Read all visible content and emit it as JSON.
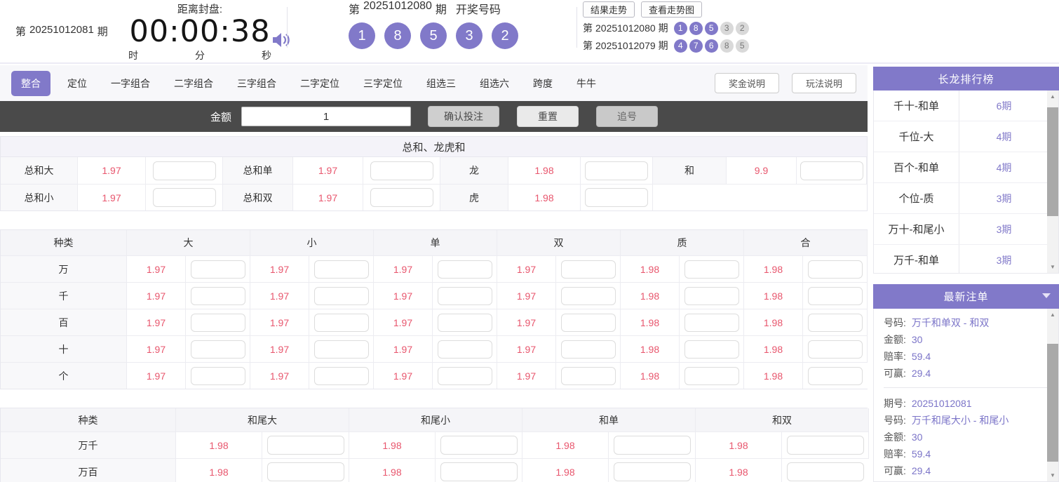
{
  "colors": {
    "accent": "#8179c9",
    "odds_red": "#e8566d",
    "ball_gray": "#d9d9d9"
  },
  "header": {
    "issue_current": {
      "prefix": "第",
      "number": "20251012081",
      "suffix": "期"
    },
    "countdown": {
      "label": "距离封盘:",
      "time": "00:00:38",
      "unit_hour": "时",
      "unit_min": "分",
      "unit_sec": "秒"
    },
    "draw": {
      "prefix": "第",
      "number": "20251012080",
      "suffix": "期",
      "title": "开奖号码",
      "balls": [
        "1",
        "8",
        "5",
        "3",
        "2"
      ]
    },
    "trend_buttons": [
      {
        "label": "结果走势"
      },
      {
        "label": "查看走势图"
      }
    ],
    "history": [
      {
        "prefix": "第",
        "number": "20251012080",
        "suffix": "期",
        "balls": [
          {
            "n": "1"
          },
          {
            "n": "8"
          },
          {
            "n": "5"
          },
          {
            "n": "3"
          },
          {
            "n": "2"
          }
        ]
      },
      {
        "prefix": "第",
        "number": "20251012079",
        "suffix": "期",
        "balls": [
          {
            "n": "4"
          },
          {
            "n": "7"
          },
          {
            "n": "6"
          },
          {
            "n": "8"
          },
          {
            "n": "5"
          }
        ]
      }
    ]
  },
  "tabs": {
    "items": [
      {
        "label": "整合",
        "active": true
      },
      {
        "label": "定位"
      },
      {
        "label": "一字组合"
      },
      {
        "label": "二字组合"
      },
      {
        "label": "三字组合"
      },
      {
        "label": "二字定位"
      },
      {
        "label": "三字定位"
      },
      {
        "label": "组选三"
      },
      {
        "label": "组选六"
      },
      {
        "label": "跨度"
      },
      {
        "label": "牛牛"
      }
    ],
    "help_buttons": [
      {
        "label": "奖金说明"
      },
      {
        "label": "玩法说明"
      }
    ]
  },
  "toolbar": {
    "amount_label": "金额",
    "amount_value": "1",
    "confirm": "确认投注",
    "reset": "重置",
    "chase": "追号"
  },
  "sum_section": {
    "title": "总和、龙虎和",
    "row1": [
      {
        "label": "总和大",
        "odds": "1.97"
      },
      {
        "label": "总和单",
        "odds": "1.97"
      },
      {
        "label": "龙",
        "odds": "1.98"
      },
      {
        "label": "和",
        "odds": "9.9"
      }
    ],
    "row2": [
      {
        "label": "总和小",
        "odds": "1.97"
      },
      {
        "label": "总和双",
        "odds": "1.97"
      },
      {
        "label": "虎",
        "odds": "1.98"
      }
    ]
  },
  "main_table": {
    "headers": [
      "种类",
      "大",
      "小",
      "单",
      "双",
      "质",
      "合"
    ],
    "rows": [
      {
        "label": "万",
        "odds": [
          "1.97",
          "1.97",
          "1.97",
          "1.97",
          "1.98",
          "1.98"
        ]
      },
      {
        "label": "千",
        "odds": [
          "1.97",
          "1.97",
          "1.97",
          "1.97",
          "1.98",
          "1.98"
        ]
      },
      {
        "label": "百",
        "odds": [
          "1.97",
          "1.97",
          "1.97",
          "1.97",
          "1.98",
          "1.98"
        ]
      },
      {
        "label": "十",
        "odds": [
          "1.97",
          "1.97",
          "1.97",
          "1.97",
          "1.98",
          "1.98"
        ]
      },
      {
        "label": "个",
        "odds": [
          "1.97",
          "1.97",
          "1.97",
          "1.97",
          "1.98",
          "1.98"
        ]
      }
    ]
  },
  "tail_table": {
    "headers": [
      "种类",
      "和尾大",
      "和尾小",
      "和单",
      "和双"
    ],
    "rows": [
      {
        "label": "万千",
        "odds": [
          "1.98",
          "1.98",
          "1.98",
          "1.98"
        ]
      },
      {
        "label": "万百",
        "odds": [
          "1.98",
          "1.98",
          "1.98",
          "1.98"
        ]
      }
    ]
  },
  "sidebar": {
    "dragon": {
      "title": "长龙排行榜",
      "rows": [
        {
          "name": "千十-和单",
          "count": "6期"
        },
        {
          "name": "千位-大",
          "count": "4期"
        },
        {
          "name": "百个-和单",
          "count": "4期"
        },
        {
          "name": "个位-质",
          "count": "3期"
        },
        {
          "name": "万十-和尾小",
          "count": "3期"
        },
        {
          "name": "万千-和单",
          "count": "3期"
        }
      ]
    },
    "latest": {
      "title": "最新注单",
      "entries": [
        {
          "fields": [
            {
              "label": "号码:",
              "value": "万千和单双 - 和双"
            },
            {
              "label": "金额:",
              "value": "30"
            },
            {
              "label": "赔率:",
              "value": "59.4"
            },
            {
              "label": "可赢:",
              "value": "29.4"
            }
          ]
        },
        {
          "fields": [
            {
              "label": "期号:",
              "value": "20251012081"
            },
            {
              "label": "号码:",
              "value": "万千和尾大小 - 和尾小"
            },
            {
              "label": "金额:",
              "value": "30"
            },
            {
              "label": "赔率:",
              "value": "59.4"
            },
            {
              "label": "可赢:",
              "value": "29.4"
            }
          ]
        }
      ]
    }
  }
}
